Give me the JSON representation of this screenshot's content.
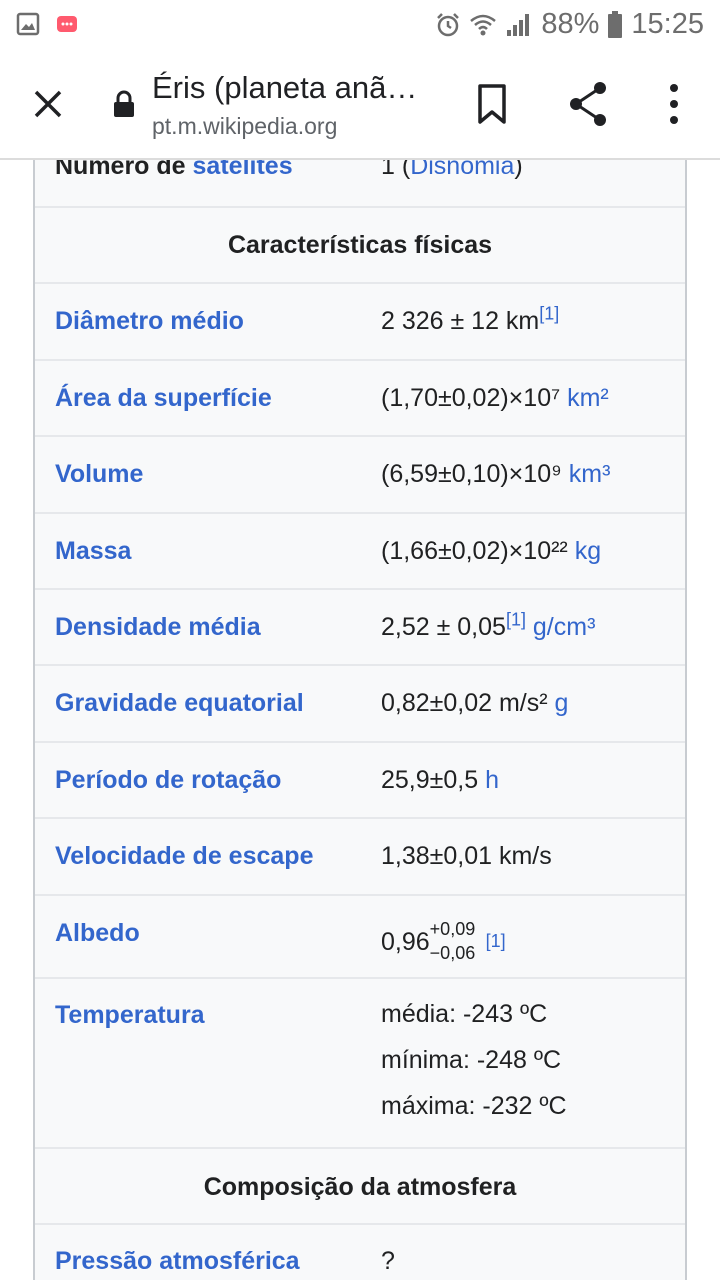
{
  "status_bar": {
    "battery": "88%",
    "time": "15:25"
  },
  "header": {
    "title": "Éris (planeta anã…",
    "url": "pt.m.wikipedia.org"
  },
  "infobox": {
    "satellites": {
      "label_prefix": "Número de ",
      "label_link": "satélites",
      "value_prefix": "1 (",
      "value_link": "Disnomia",
      "value_suffix": ")"
    },
    "section_physical": "Características físicas",
    "rows": [
      {
        "label": "Diâmetro médio",
        "value": "2 326 ± 12 km",
        "ref": "[1]"
      },
      {
        "label": "Área da superfície",
        "value": "(1,70±0,02)×10⁷ ",
        "unit": "km²"
      },
      {
        "label": "Volume",
        "value": "(6,59±0,10)×10⁹ ",
        "unit": "km³"
      },
      {
        "label": "Massa",
        "value": "(1,66±0,02)×10²² ",
        "unit": "kg"
      },
      {
        "label": "Densidade média",
        "value": "2,52 ± 0,05",
        "ref": "[1]",
        "unit": " g/cm³"
      },
      {
        "label": "Gravidade equatorial",
        "value": "0,82±0,02 m/s² ",
        "unit": "g"
      },
      {
        "label": "Período de rotação",
        "value": "25,9±0,5 ",
        "unit": "h"
      },
      {
        "label": "Velocidade de escape",
        "value": "1,38±0,01 km/s"
      }
    ],
    "albedo": {
      "label": "Albedo",
      "base": "0,96",
      "plus": "+0,09",
      "minus": "−0,06",
      "ref": "[1]"
    },
    "temperature": {
      "label": "Temperatura",
      "mean": "média: -243 ºC",
      "min": "mínima: -248 ºC",
      "max": "máxima: -232 ºC"
    },
    "section_atmosphere": "Composição da atmosfera",
    "pressure": {
      "label": "Pressão atmosférica",
      "value": "?"
    }
  }
}
